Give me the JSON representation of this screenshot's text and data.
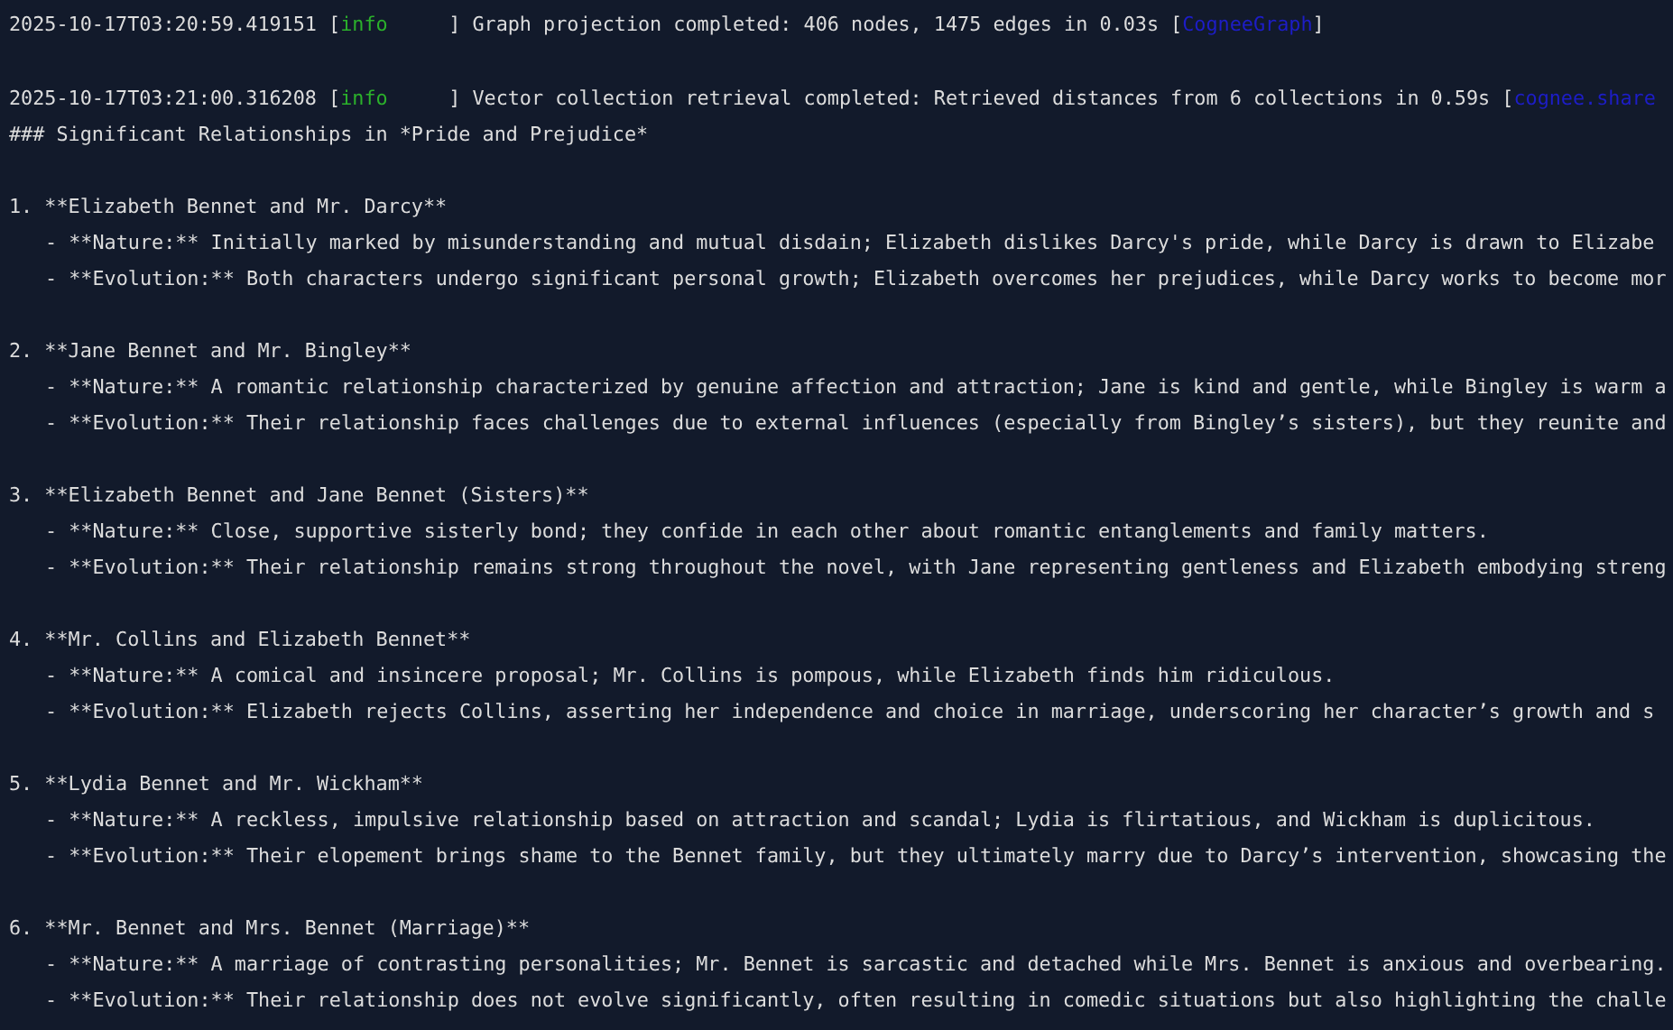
{
  "logs": [
    {
      "timestamp": "2025-10-17T03:20:59.419151 [",
      "severity": "info",
      "message": "] Graph projection completed: 406 nodes, 1475 edges in 0.03s [",
      "logger": "CogneeGraph",
      "tail": "]"
    },
    {
      "timestamp": "2025-10-17T03:21:00.316208 [",
      "severity": "info",
      "message": "] Vector collection retrieval completed: Retrieved distances from 6 collections in 0.59s [",
      "logger": "cognee.share"
    }
  ],
  "answer": {
    "heading": "### Significant Relationships in *Pride and Prejudice*",
    "items": [
      {
        "title": "1. **Elizabeth Bennet and Mr. Darcy**",
        "points": [
          "- **Nature:** Initially marked by misunderstanding and mutual disdain; Elizabeth dislikes Darcy's pride, while Darcy is drawn to Elizabe",
          "- **Evolution:** Both characters undergo significant personal growth; Elizabeth overcomes her prejudices, while Darcy works to become mor"
        ]
      },
      {
        "title": "2. **Jane Bennet and Mr. Bingley**",
        "points": [
          "- **Nature:** A romantic relationship characterized by genuine affection and attraction; Jane is kind and gentle, while Bingley is warm a",
          "- **Evolution:** Their relationship faces challenges due to external influences (especially from Bingley’s sisters), but they reunite and"
        ]
      },
      {
        "title": "3. **Elizabeth Bennet and Jane Bennet (Sisters)**",
        "points": [
          "- **Nature:** Close, supportive sisterly bond; they confide in each other about romantic entanglements and family matters.",
          "- **Evolution:** Their relationship remains strong throughout the novel, with Jane representing gentleness and Elizabeth embodying streng"
        ]
      },
      {
        "title": "4. **Mr. Collins and Elizabeth Bennet**",
        "points": [
          "- **Nature:** A comical and insincere proposal; Mr. Collins is pompous, while Elizabeth finds him ridiculous.",
          "- **Evolution:** Elizabeth rejects Collins, asserting her independence and choice in marriage, underscoring her character’s growth and s"
        ]
      },
      {
        "title": "5. **Lydia Bennet and Mr. Wickham**",
        "points": [
          "- **Nature:** A reckless, impulsive relationship based on attraction and scandal; Lydia is flirtatious, and Wickham is duplicitous.",
          "- **Evolution:** Their elopement brings shame to the Bennet family, but they ultimately marry due to Darcy’s intervention, showcasing the"
        ]
      },
      {
        "title": "6. **Mr. Bennet and Mrs. Bennet (Marriage)**",
        "points": [
          "- **Nature:** A marriage of contrasting personalities; Mr. Bennet is sarcastic and detached while Mrs. Bennet is anxious and overbearing.",
          "- **Evolution:** Their relationship does not evolve significantly, often resulting in comedic situations but also highlighting the challe"
        ]
      }
    ]
  }
}
